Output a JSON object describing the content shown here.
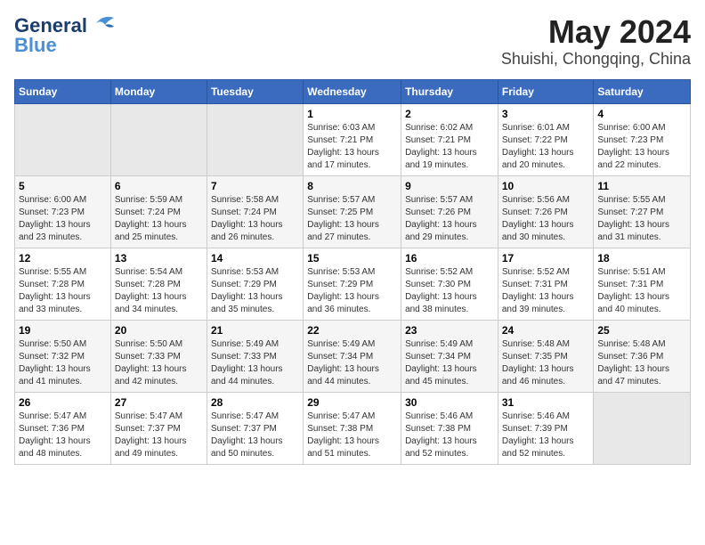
{
  "logo": {
    "text_general": "General",
    "text_blue": "Blue"
  },
  "title": "May 2024",
  "subtitle": "Shuishi, Chongqing, China",
  "days_header": [
    "Sunday",
    "Monday",
    "Tuesday",
    "Wednesday",
    "Thursday",
    "Friday",
    "Saturday"
  ],
  "weeks": [
    {
      "cells": [
        {
          "day": "",
          "info": ""
        },
        {
          "day": "",
          "info": ""
        },
        {
          "day": "",
          "info": ""
        },
        {
          "day": "1",
          "info": "Sunrise: 6:03 AM\nSunset: 7:21 PM\nDaylight: 13 hours\nand 17 minutes."
        },
        {
          "day": "2",
          "info": "Sunrise: 6:02 AM\nSunset: 7:21 PM\nDaylight: 13 hours\nand 19 minutes."
        },
        {
          "day": "3",
          "info": "Sunrise: 6:01 AM\nSunset: 7:22 PM\nDaylight: 13 hours\nand 20 minutes."
        },
        {
          "day": "4",
          "info": "Sunrise: 6:00 AM\nSunset: 7:23 PM\nDaylight: 13 hours\nand 22 minutes."
        }
      ]
    },
    {
      "cells": [
        {
          "day": "5",
          "info": "Sunrise: 6:00 AM\nSunset: 7:23 PM\nDaylight: 13 hours\nand 23 minutes."
        },
        {
          "day": "6",
          "info": "Sunrise: 5:59 AM\nSunset: 7:24 PM\nDaylight: 13 hours\nand 25 minutes."
        },
        {
          "day": "7",
          "info": "Sunrise: 5:58 AM\nSunset: 7:24 PM\nDaylight: 13 hours\nand 26 minutes."
        },
        {
          "day": "8",
          "info": "Sunrise: 5:57 AM\nSunset: 7:25 PM\nDaylight: 13 hours\nand 27 minutes."
        },
        {
          "day": "9",
          "info": "Sunrise: 5:57 AM\nSunset: 7:26 PM\nDaylight: 13 hours\nand 29 minutes."
        },
        {
          "day": "10",
          "info": "Sunrise: 5:56 AM\nSunset: 7:26 PM\nDaylight: 13 hours\nand 30 minutes."
        },
        {
          "day": "11",
          "info": "Sunrise: 5:55 AM\nSunset: 7:27 PM\nDaylight: 13 hours\nand 31 minutes."
        }
      ]
    },
    {
      "cells": [
        {
          "day": "12",
          "info": "Sunrise: 5:55 AM\nSunset: 7:28 PM\nDaylight: 13 hours\nand 33 minutes."
        },
        {
          "day": "13",
          "info": "Sunrise: 5:54 AM\nSunset: 7:28 PM\nDaylight: 13 hours\nand 34 minutes."
        },
        {
          "day": "14",
          "info": "Sunrise: 5:53 AM\nSunset: 7:29 PM\nDaylight: 13 hours\nand 35 minutes."
        },
        {
          "day": "15",
          "info": "Sunrise: 5:53 AM\nSunset: 7:29 PM\nDaylight: 13 hours\nand 36 minutes."
        },
        {
          "day": "16",
          "info": "Sunrise: 5:52 AM\nSunset: 7:30 PM\nDaylight: 13 hours\nand 38 minutes."
        },
        {
          "day": "17",
          "info": "Sunrise: 5:52 AM\nSunset: 7:31 PM\nDaylight: 13 hours\nand 39 minutes."
        },
        {
          "day": "18",
          "info": "Sunrise: 5:51 AM\nSunset: 7:31 PM\nDaylight: 13 hours\nand 40 minutes."
        }
      ]
    },
    {
      "cells": [
        {
          "day": "19",
          "info": "Sunrise: 5:50 AM\nSunset: 7:32 PM\nDaylight: 13 hours\nand 41 minutes."
        },
        {
          "day": "20",
          "info": "Sunrise: 5:50 AM\nSunset: 7:33 PM\nDaylight: 13 hours\nand 42 minutes."
        },
        {
          "day": "21",
          "info": "Sunrise: 5:49 AM\nSunset: 7:33 PM\nDaylight: 13 hours\nand 44 minutes."
        },
        {
          "day": "22",
          "info": "Sunrise: 5:49 AM\nSunset: 7:34 PM\nDaylight: 13 hours\nand 44 minutes."
        },
        {
          "day": "23",
          "info": "Sunrise: 5:49 AM\nSunset: 7:34 PM\nDaylight: 13 hours\nand 45 minutes."
        },
        {
          "day": "24",
          "info": "Sunrise: 5:48 AM\nSunset: 7:35 PM\nDaylight: 13 hours\nand 46 minutes."
        },
        {
          "day": "25",
          "info": "Sunrise: 5:48 AM\nSunset: 7:36 PM\nDaylight: 13 hours\nand 47 minutes."
        }
      ]
    },
    {
      "cells": [
        {
          "day": "26",
          "info": "Sunrise: 5:47 AM\nSunset: 7:36 PM\nDaylight: 13 hours\nand 48 minutes."
        },
        {
          "day": "27",
          "info": "Sunrise: 5:47 AM\nSunset: 7:37 PM\nDaylight: 13 hours\nand 49 minutes."
        },
        {
          "day": "28",
          "info": "Sunrise: 5:47 AM\nSunset: 7:37 PM\nDaylight: 13 hours\nand 50 minutes."
        },
        {
          "day": "29",
          "info": "Sunrise: 5:47 AM\nSunset: 7:38 PM\nDaylight: 13 hours\nand 51 minutes."
        },
        {
          "day": "30",
          "info": "Sunrise: 5:46 AM\nSunset: 7:38 PM\nDaylight: 13 hours\nand 52 minutes."
        },
        {
          "day": "31",
          "info": "Sunrise: 5:46 AM\nSunset: 7:39 PM\nDaylight: 13 hours\nand 52 minutes."
        },
        {
          "day": "",
          "info": ""
        }
      ]
    }
  ]
}
